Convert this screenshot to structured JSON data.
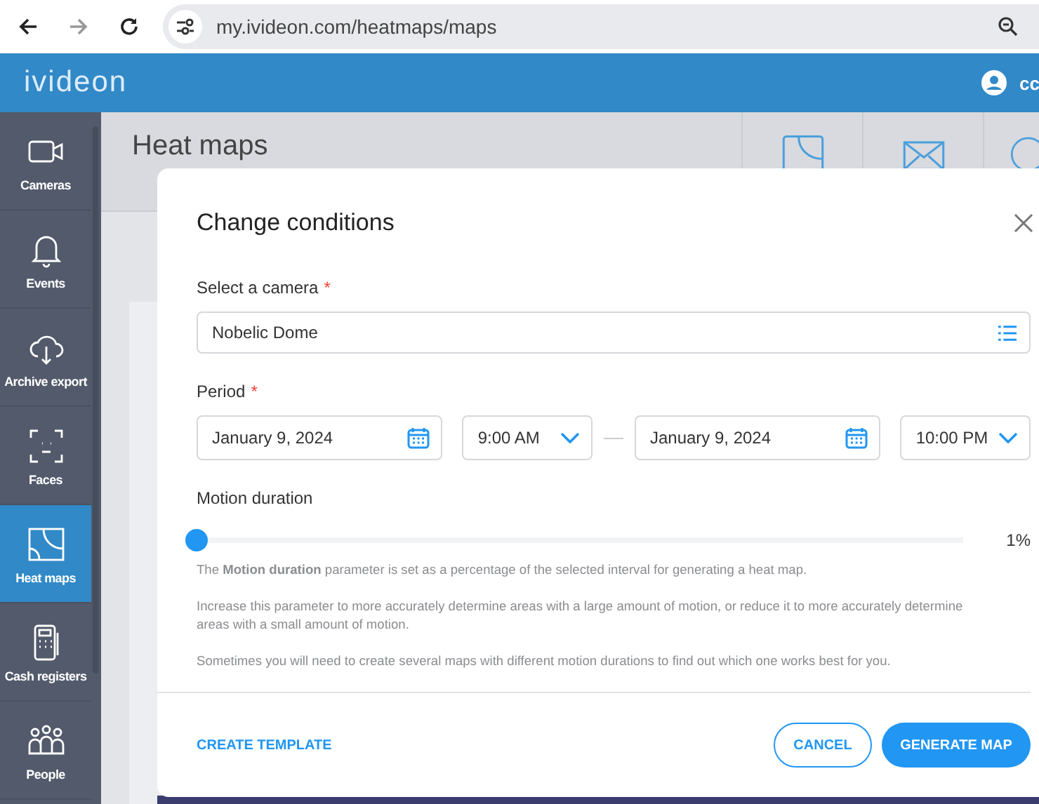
{
  "browser": {
    "url": "my.ivideon.com/heatmaps/maps"
  },
  "header": {
    "logo": "ivideon",
    "user": "cc"
  },
  "sidebar": {
    "items": [
      {
        "label": "Cameras",
        "kind": "camera",
        "selected": false
      },
      {
        "label": "Events",
        "kind": "bell",
        "selected": false
      },
      {
        "label": "Archive export",
        "kind": "cloud",
        "selected": false
      },
      {
        "label": "Faces",
        "kind": "face",
        "selected": false
      },
      {
        "label": "Heat maps",
        "kind": "heatmap",
        "selected": true
      },
      {
        "label": "Cash registers",
        "kind": "register",
        "selected": false
      },
      {
        "label": "People",
        "kind": "people",
        "selected": false
      }
    ]
  },
  "page": {
    "title": "Heat maps"
  },
  "modal": {
    "title": "Change conditions",
    "camera": {
      "label": "Select a camera",
      "required": "*",
      "value": "Nobelic Dome"
    },
    "period": {
      "label": "Period",
      "required": "*",
      "start_date": "January 9, 2024",
      "start_time": "9:00 AM",
      "end_date": "January 9, 2024",
      "end_time": "10:00 PM"
    },
    "motion": {
      "label": "Motion duration",
      "level": 0.0,
      "reading": "1%"
    },
    "help": [
      "The **Motion duration** parameter is set as a percentage of the selected interval for generating a heat map.",
      "Increase this parameter to more accurately determine areas with a large amount of motion, or reduce it to more accurately determine areas with a small amount of motion.",
      "Sometimes you will need to create several maps with different motion durations to find out which one works best for you."
    ],
    "template_link": "CREATE TEMPLATE",
    "cancel": "CANCEL",
    "submit": "GENERATE MAP"
  }
}
